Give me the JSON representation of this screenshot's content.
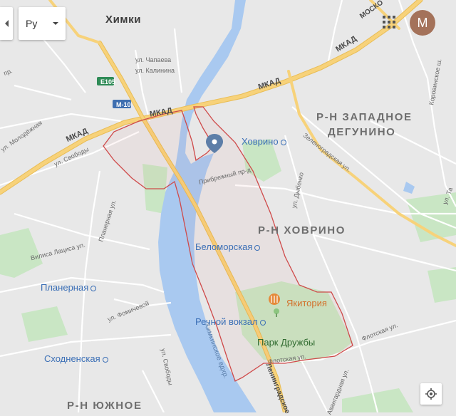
{
  "map": {
    "controls": {
      "layer_label": "Ру",
      "avatar_letter": "М"
    },
    "cities": [
      "Химки"
    ],
    "districts": {
      "zapadnoe_line1": "Р-Н ЗАПАДНОЕ",
      "zapadnoe_line2": "ДЕГУНИНО",
      "khovrino": "Р-Н ХОВРИНО",
      "yuzhnoe": "Р-Н ЮЖНОЕ"
    },
    "roads": {
      "mkad": "МКАД",
      "m10": "М-10",
      "e105": "Е105",
      "leningradskoe": "Ленинградское",
      "moskovskaya": "МОСКО"
    },
    "pois": {
      "khovrino": "Ховрино",
      "belomorskaya": "Беломорская",
      "rechnoy_vokzal": "Речной вокзал",
      "planernaya": "Планерная",
      "skhodnenskaya": "Сходненская",
      "yakitoria": "Якитория",
      "park_druzhby": "Парк Дружбы"
    },
    "streets": {
      "chapaeva": "ул. Чапаева",
      "kalinina": "ул. Калинина",
      "molodezhnaya": "ул. Молодёжная",
      "svobody1": "ул. Свободы",
      "svobody2": "ул. Свободы",
      "priberezhny": "Прибрежный пр-д",
      "dybenko": "ул. Дыбенко",
      "zelenogradskaya": "Зеленоградская ул.",
      "planernaya_ul": "Планерная ул.",
      "vilisa_latsisa": "Вилиса Лациса ул.",
      "fomichevoy": "ул. Фомичевой",
      "flotskaya1": "Флотская ул.",
      "flotskaya2": "Флотская ул.",
      "khimkinsky_bulvar": "Химкинское вдхр.",
      "korovinskoe": "Коровинское ш.",
      "talbukhina": "ул. Та",
      "avangardnaya": "Авангардная ул.",
      "pr_small": "пр."
    }
  }
}
